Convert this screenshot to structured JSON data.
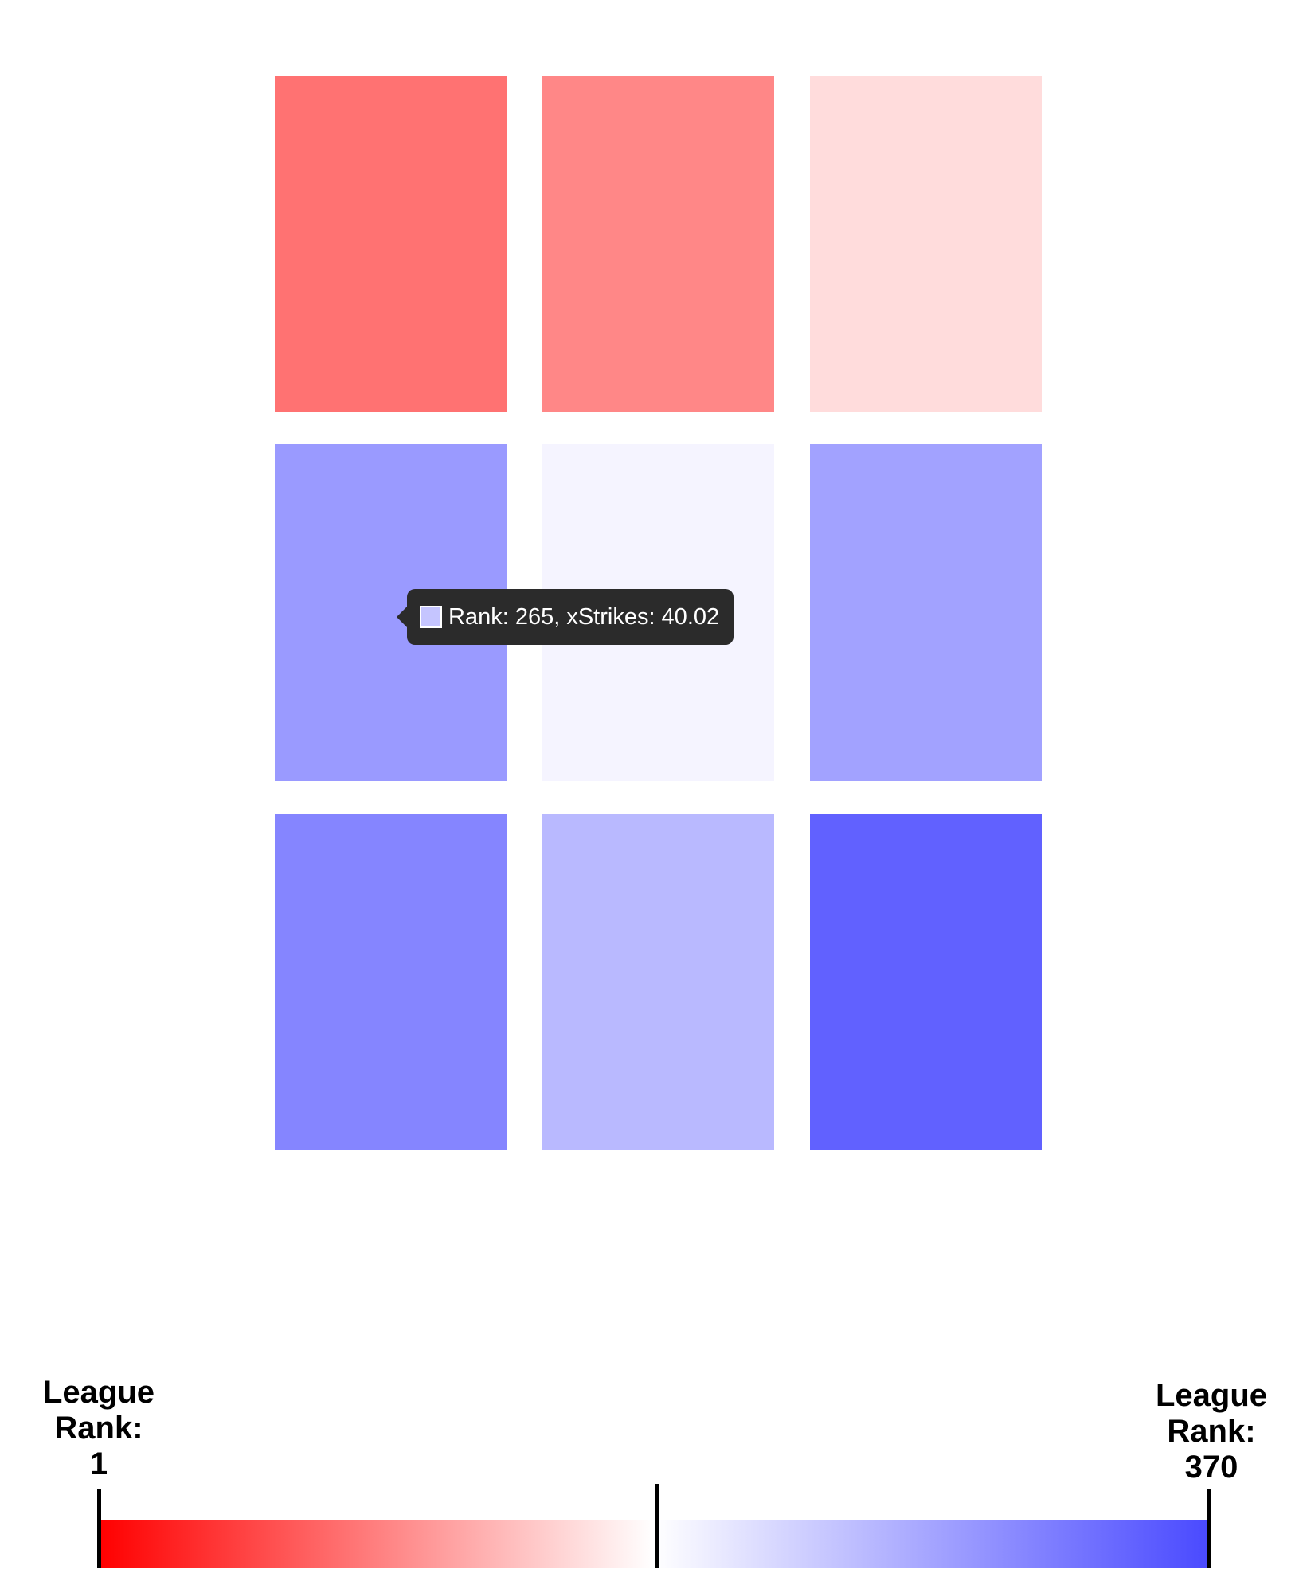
{
  "chart_data": {
    "type": "heatmap",
    "rows": 3,
    "cols": 3,
    "cells": [
      {
        "row": 0,
        "col": 0,
        "color": "#ff7272"
      },
      {
        "row": 0,
        "col": 1,
        "color": "#ff8787"
      },
      {
        "row": 0,
        "col": 2,
        "color": "#ffdcdc"
      },
      {
        "row": 1,
        "col": 0,
        "color": "#9a9aff"
      },
      {
        "row": 1,
        "col": 1,
        "color": "#f5f4ff"
      },
      {
        "row": 1,
        "col": 2,
        "color": "#a2a2ff"
      },
      {
        "row": 2,
        "col": 0,
        "color": "#8585ff"
      },
      {
        "row": 2,
        "col": 1,
        "color": "#b9b9ff"
      },
      {
        "row": 2,
        "col": 2,
        "color": "#6161ff"
      }
    ],
    "tooltip": {
      "text": "Rank: 265, xStrikes: 40.02",
      "swatch_color": "#c5c5ff",
      "rank": 265,
      "xStrikes": 40.02
    },
    "legend": {
      "min_label": [
        "League",
        "Rank:",
        "1"
      ],
      "max_label": [
        "League",
        "Rank:",
        "370"
      ],
      "min_rank": 1,
      "max_rank": 370,
      "color_low": "#ff0000",
      "color_mid": "#ffffff",
      "color_high": "#4a4aff"
    }
  }
}
